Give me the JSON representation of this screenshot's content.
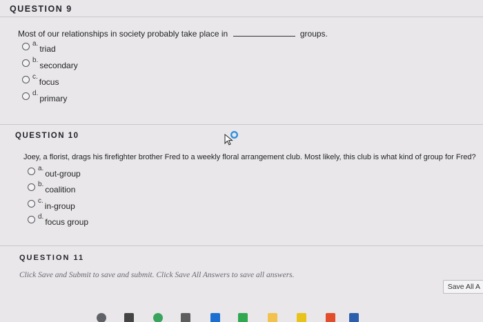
{
  "questions": [
    {
      "header": "QUESTION 9",
      "text_before": "Most of our relationships in society probably take place in",
      "text_after": "groups.",
      "options": [
        {
          "letter": "a.",
          "label": "triad"
        },
        {
          "letter": "b.",
          "label": "secondary"
        },
        {
          "letter": "c.",
          "label": "focus"
        },
        {
          "letter": "d.",
          "label": "primary"
        }
      ]
    },
    {
      "header": "QUESTION 10",
      "text": "Joey, a florist, drags his firefighter brother Fred to a weekly floral arrangement club. Most likely, this club is what kind of group for Fred?",
      "options": [
        {
          "letter": "a.",
          "label": "out-group"
        },
        {
          "letter": "b.",
          "label": "coalition"
        },
        {
          "letter": "c.",
          "label": "in-group"
        },
        {
          "letter": "d.",
          "label": "focus group"
        }
      ]
    },
    {
      "header": "QUESTION 11"
    }
  ],
  "footer": {
    "instructions": "Click Save and Submit to save and submit. Click Save All Answers to save all answers.",
    "save_all_label": "Save All A"
  },
  "colors": {
    "background": "#e9e7ea",
    "cursor_ring": "#2f8fe0"
  },
  "taskbar_icons": [
    "chrome-icon",
    "calculator-icon",
    "maps-icon",
    "photos-icon",
    "keynote-icon",
    "numbers-icon",
    "notes-icon",
    "app-store-icon",
    "messages-icon",
    "word-icon"
  ]
}
